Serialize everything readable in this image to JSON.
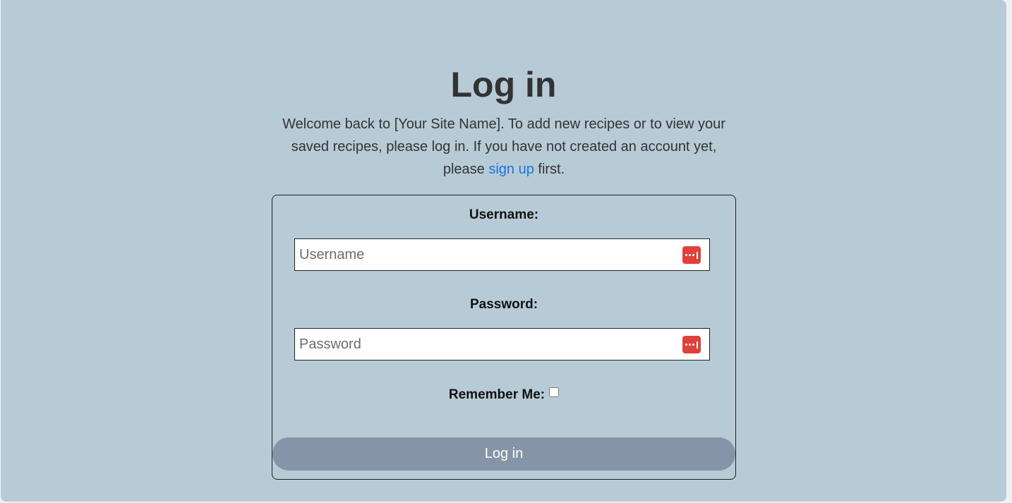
{
  "heading": "Log in",
  "intro": {
    "text_before_link": "Welcome back to [Your Site Name]. To add new recipes or to view your saved recipes, please log in. If you have not created an account yet, please ",
    "link_text": "sign up",
    "text_after_link": " first."
  },
  "form": {
    "username": {
      "label": "Username:",
      "placeholder": "Username",
      "value": ""
    },
    "password": {
      "label": "Password:",
      "placeholder": "Password",
      "value": ""
    },
    "remember": {
      "label": "Remember Me:",
      "checked": false
    },
    "submit_label": "Log in"
  },
  "icons": {
    "password_manager": "password-manager-icon"
  },
  "colors": {
    "page_background": "#b7cbd6",
    "link": "#1a73e8",
    "button": "#8594a6",
    "password_manager_icon": "#e0413c"
  }
}
